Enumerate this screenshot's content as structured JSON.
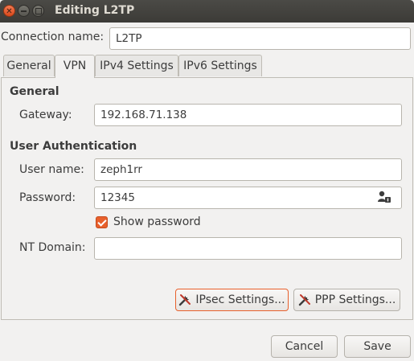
{
  "window": {
    "title": "Editing L2TP"
  },
  "connection": {
    "label": "Connection name:",
    "value": "L2TP"
  },
  "tabs": [
    {
      "label": "General"
    },
    {
      "label": "VPN"
    },
    {
      "label": "IPv4 Settings"
    },
    {
      "label": "IPv6 Settings"
    }
  ],
  "active_tab": "VPN",
  "vpn": {
    "general_heading": "General",
    "gateway_label": "Gateway:",
    "gateway_value": "192.168.71.138",
    "auth_heading": "User Authentication",
    "username_label": "User name:",
    "username_value": "zeph1rr",
    "password_label": "Password:",
    "password_value": "12345",
    "show_password_label": "Show password",
    "show_password_checked": true,
    "nt_domain_label": "NT Domain:",
    "nt_domain_value": "",
    "ipsec_button": "IPsec Settings...",
    "ppp_button": "PPP Settings..."
  },
  "footer": {
    "cancel": "Cancel",
    "save": "Save"
  },
  "colors": {
    "accent": "#e8602c",
    "titlebar": "#3c3b37",
    "window_bg": "#f2f1f0"
  },
  "icons": {
    "password_storage": "user-key-icon",
    "settings_buttons": "tools-icon"
  }
}
